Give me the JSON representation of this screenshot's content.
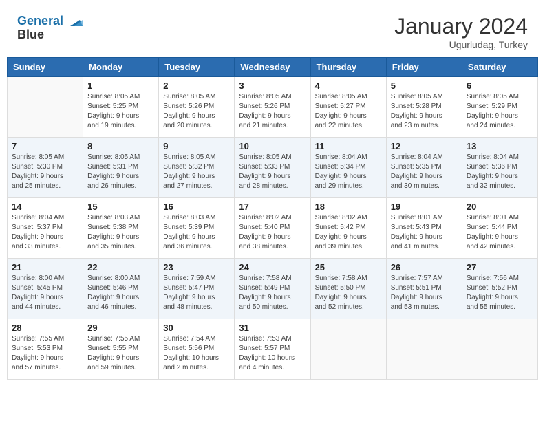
{
  "header": {
    "logo_line1": "General",
    "logo_line2": "Blue",
    "month_title": "January 2024",
    "location": "Ugurludag, Turkey"
  },
  "days_of_week": [
    "Sunday",
    "Monday",
    "Tuesday",
    "Wednesday",
    "Thursday",
    "Friday",
    "Saturday"
  ],
  "weeks": [
    [
      {
        "day": "",
        "info": ""
      },
      {
        "day": "1",
        "info": "Sunrise: 8:05 AM\nSunset: 5:25 PM\nDaylight: 9 hours\nand 19 minutes."
      },
      {
        "day": "2",
        "info": "Sunrise: 8:05 AM\nSunset: 5:26 PM\nDaylight: 9 hours\nand 20 minutes."
      },
      {
        "day": "3",
        "info": "Sunrise: 8:05 AM\nSunset: 5:26 PM\nDaylight: 9 hours\nand 21 minutes."
      },
      {
        "day": "4",
        "info": "Sunrise: 8:05 AM\nSunset: 5:27 PM\nDaylight: 9 hours\nand 22 minutes."
      },
      {
        "day": "5",
        "info": "Sunrise: 8:05 AM\nSunset: 5:28 PM\nDaylight: 9 hours\nand 23 minutes."
      },
      {
        "day": "6",
        "info": "Sunrise: 8:05 AM\nSunset: 5:29 PM\nDaylight: 9 hours\nand 24 minutes."
      }
    ],
    [
      {
        "day": "7",
        "info": "Sunrise: 8:05 AM\nSunset: 5:30 PM\nDaylight: 9 hours\nand 25 minutes."
      },
      {
        "day": "8",
        "info": "Sunrise: 8:05 AM\nSunset: 5:31 PM\nDaylight: 9 hours\nand 26 minutes."
      },
      {
        "day": "9",
        "info": "Sunrise: 8:05 AM\nSunset: 5:32 PM\nDaylight: 9 hours\nand 27 minutes."
      },
      {
        "day": "10",
        "info": "Sunrise: 8:05 AM\nSunset: 5:33 PM\nDaylight: 9 hours\nand 28 minutes."
      },
      {
        "day": "11",
        "info": "Sunrise: 8:04 AM\nSunset: 5:34 PM\nDaylight: 9 hours\nand 29 minutes."
      },
      {
        "day": "12",
        "info": "Sunrise: 8:04 AM\nSunset: 5:35 PM\nDaylight: 9 hours\nand 30 minutes."
      },
      {
        "day": "13",
        "info": "Sunrise: 8:04 AM\nSunset: 5:36 PM\nDaylight: 9 hours\nand 32 minutes."
      }
    ],
    [
      {
        "day": "14",
        "info": "Sunrise: 8:04 AM\nSunset: 5:37 PM\nDaylight: 9 hours\nand 33 minutes."
      },
      {
        "day": "15",
        "info": "Sunrise: 8:03 AM\nSunset: 5:38 PM\nDaylight: 9 hours\nand 35 minutes."
      },
      {
        "day": "16",
        "info": "Sunrise: 8:03 AM\nSunset: 5:39 PM\nDaylight: 9 hours\nand 36 minutes."
      },
      {
        "day": "17",
        "info": "Sunrise: 8:02 AM\nSunset: 5:40 PM\nDaylight: 9 hours\nand 38 minutes."
      },
      {
        "day": "18",
        "info": "Sunrise: 8:02 AM\nSunset: 5:42 PM\nDaylight: 9 hours\nand 39 minutes."
      },
      {
        "day": "19",
        "info": "Sunrise: 8:01 AM\nSunset: 5:43 PM\nDaylight: 9 hours\nand 41 minutes."
      },
      {
        "day": "20",
        "info": "Sunrise: 8:01 AM\nSunset: 5:44 PM\nDaylight: 9 hours\nand 42 minutes."
      }
    ],
    [
      {
        "day": "21",
        "info": "Sunrise: 8:00 AM\nSunset: 5:45 PM\nDaylight: 9 hours\nand 44 minutes."
      },
      {
        "day": "22",
        "info": "Sunrise: 8:00 AM\nSunset: 5:46 PM\nDaylight: 9 hours\nand 46 minutes."
      },
      {
        "day": "23",
        "info": "Sunrise: 7:59 AM\nSunset: 5:47 PM\nDaylight: 9 hours\nand 48 minutes."
      },
      {
        "day": "24",
        "info": "Sunrise: 7:58 AM\nSunset: 5:49 PM\nDaylight: 9 hours\nand 50 minutes."
      },
      {
        "day": "25",
        "info": "Sunrise: 7:58 AM\nSunset: 5:50 PM\nDaylight: 9 hours\nand 52 minutes."
      },
      {
        "day": "26",
        "info": "Sunrise: 7:57 AM\nSunset: 5:51 PM\nDaylight: 9 hours\nand 53 minutes."
      },
      {
        "day": "27",
        "info": "Sunrise: 7:56 AM\nSunset: 5:52 PM\nDaylight: 9 hours\nand 55 minutes."
      }
    ],
    [
      {
        "day": "28",
        "info": "Sunrise: 7:55 AM\nSunset: 5:53 PM\nDaylight: 9 hours\nand 57 minutes."
      },
      {
        "day": "29",
        "info": "Sunrise: 7:55 AM\nSunset: 5:55 PM\nDaylight: 9 hours\nand 59 minutes."
      },
      {
        "day": "30",
        "info": "Sunrise: 7:54 AM\nSunset: 5:56 PM\nDaylight: 10 hours\nand 2 minutes."
      },
      {
        "day": "31",
        "info": "Sunrise: 7:53 AM\nSunset: 5:57 PM\nDaylight: 10 hours\nand 4 minutes."
      },
      {
        "day": "",
        "info": ""
      },
      {
        "day": "",
        "info": ""
      },
      {
        "day": "",
        "info": ""
      }
    ]
  ]
}
